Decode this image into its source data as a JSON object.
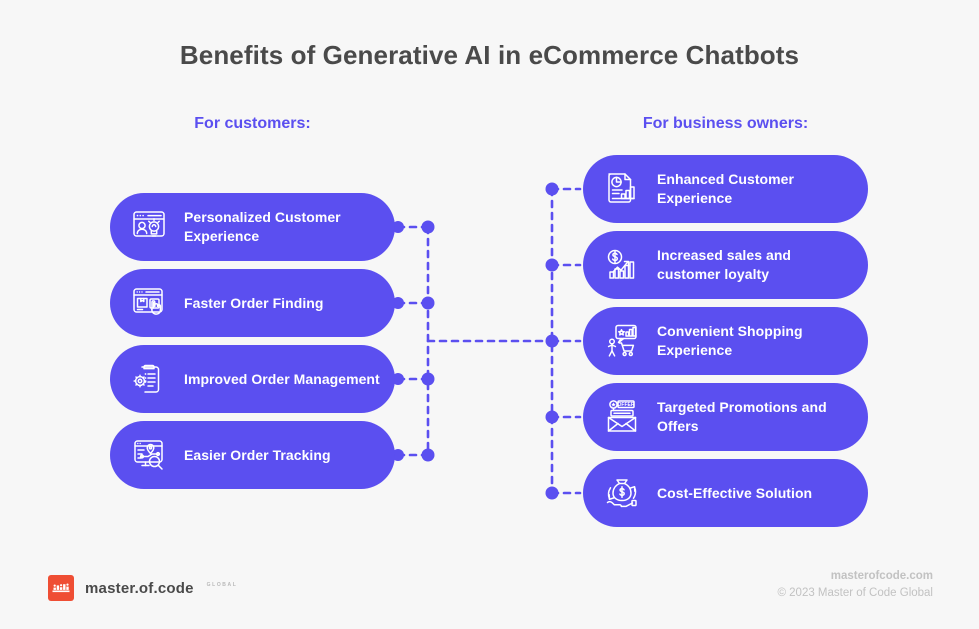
{
  "page": {
    "title": "Benefits of Generative AI in eCommerce Chatbots",
    "background_color": "#f7f7f7",
    "accent_color": "#5b4ff0",
    "title_color": "#4a4a4a",
    "logo_color": "#ef4e34"
  },
  "columns": {
    "left": {
      "heading": "For customers:",
      "cards": [
        {
          "label": "Personalized Customer Experience",
          "icon": "browser-person-lightbulb-icon"
        },
        {
          "label": "Faster Order Finding",
          "icon": "browser-package-cursor-icon"
        },
        {
          "label": "Improved Order Management",
          "icon": "clipboard-gear-icon"
        },
        {
          "label": "Easier Order Tracking",
          "icon": "map-route-magnifier-icon"
        }
      ]
    },
    "right": {
      "heading": "For business owners:",
      "cards": [
        {
          "label": "Enhanced Customer Experience",
          "icon": "report-piechart-bars-icon"
        },
        {
          "label": "Increased sales and customer loyalty",
          "icon": "dollar-growth-chart-icon"
        },
        {
          "label": "Convenient Shopping Experience",
          "icon": "shopper-cart-chart-icon"
        },
        {
          "label": "Targeted Promotions and Offers",
          "icon": "envelope-offer-icon"
        },
        {
          "label": "Cost-Effective Solution",
          "icon": "money-bag-hand-icon"
        }
      ]
    }
  },
  "footer": {
    "logo_wordmark": "master.of.code",
    "logo_sub": "GLOBAL",
    "site": "masterofcode.com",
    "copyright": "© 2023 Master of Code Global"
  }
}
